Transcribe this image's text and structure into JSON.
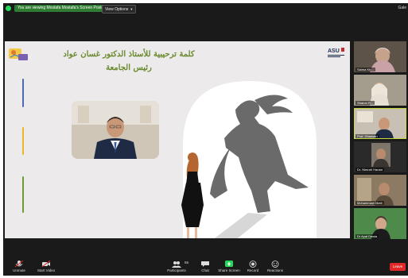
{
  "topbar": {
    "viewing_text": "You are viewing Mostafa Mostafa's Screen Poster",
    "view_options": "View Options",
    "right_text": "Gale"
  },
  "slide": {
    "title_line1": "كلمة ترحيبية للأستاذ الدكتور غسان عواد",
    "title_line2": "رئيس الجامعة",
    "logo_right_text": "ASU"
  },
  "gallery": [
    {
      "name": "Salma Kh..."
    },
    {
      "name": "Sharon R..."
    },
    {
      "name": "Prof. Ghassan"
    },
    {
      "name": "Dr. Nimrah Haram"
    },
    {
      "name": "Mohammad Dbeir"
    },
    {
      "name": "Dr Ayat Dawla"
    }
  ],
  "controls": {
    "unmute": "Unmute",
    "start_video": "Start Video",
    "participants": "Participants",
    "participants_count": "56",
    "chat": "Chat",
    "share_screen": "Share Screen",
    "record": "Record",
    "reactions": "Reactions",
    "leave": "Leave"
  },
  "colors": {
    "title_green": "#6a8a2e",
    "leave_red": "#e02828",
    "share_green": "#23d959",
    "active_speaker": "#c8d93a"
  }
}
